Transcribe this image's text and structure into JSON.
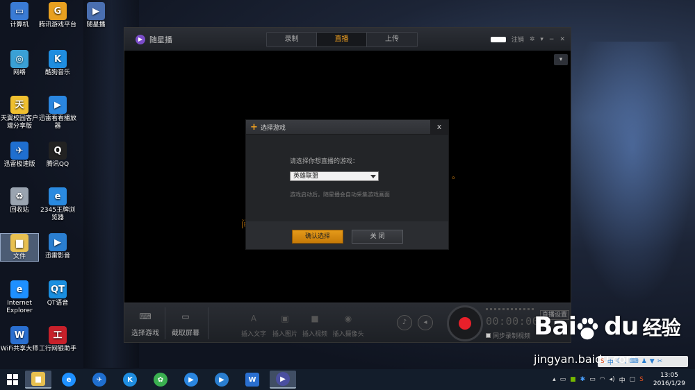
{
  "desktop": {
    "icons": [
      {
        "label": "计算机",
        "color": "#3a7bd5",
        "glyph": "▭"
      },
      {
        "label": "腾讯游戏平台",
        "color": "#e8a020",
        "glyph": "G"
      },
      {
        "label": "随星播",
        "color": "#4a6fb0",
        "glyph": "▶"
      },
      {
        "label": "网络",
        "color": "#3aa0d5",
        "glyph": "◎"
      },
      {
        "label": "酷狗音乐",
        "color": "#1f8de0",
        "glyph": "K"
      },
      {
        "label": "天翼校园客户端分享版",
        "color": "#f0c030",
        "glyph": "天"
      },
      {
        "label": "迅雷看看播放器",
        "color": "#2a86e0",
        "glyph": "▶"
      },
      {
        "label": "迅雷极速版",
        "color": "#1f6fd0",
        "glyph": "✈"
      },
      {
        "label": "腾讯QQ",
        "color": "#222",
        "glyph": "Q"
      },
      {
        "label": "回收站",
        "color": "#9aa4b0",
        "glyph": "♻"
      },
      {
        "label": "2345王牌浏览器",
        "color": "#2a8ae0",
        "glyph": "e"
      },
      {
        "label": "文件",
        "color": "#e8c050",
        "glyph": "▆"
      },
      {
        "label": "迅雷影音",
        "color": "#2a7ed0",
        "glyph": "▶"
      },
      {
        "label": "Internet Explorer",
        "color": "#1e90ff",
        "glyph": "e"
      },
      {
        "label": "QT语音",
        "color": "#1a8fe0",
        "glyph": "QT"
      },
      {
        "label": "WiFi共享大师",
        "color": "#2a6fd0",
        "glyph": "W"
      },
      {
        "label": "工行网银助手",
        "color": "#c8202a",
        "glyph": "工"
      }
    ]
  },
  "app": {
    "title": "随星播",
    "tabs": [
      {
        "label": "录制",
        "active": false
      },
      {
        "label": "直播",
        "active": true
      },
      {
        "label": "上传",
        "active": false
      }
    ],
    "logout_label": "注销",
    "skin_icon": "shirt-icon",
    "background_hint_left": "间",
    "background_hint_right": "。",
    "toolbar": {
      "select_game": "选择游戏",
      "capture_screen": "截取屏幕",
      "insert_text": "插入文字",
      "insert_image": "插入图片",
      "insert_video": "插入视频",
      "insert_camera": "插入摄像头",
      "timer": "00:00:00",
      "sync_record": "同步录制视频",
      "live_settings": "直播设置"
    },
    "colors": {
      "accent": "#f0a020",
      "record": "#e8202a"
    }
  },
  "dialog": {
    "title": "选择游戏",
    "close_glyph": "x",
    "prompt": "请选择你想直播的游戏：",
    "selected_game": "英雄联盟",
    "hint": "游戏启动后，随星播会自动采集游戏画面",
    "confirm_label": "确认选择",
    "close_label": "关 闭"
  },
  "watermark": {
    "brand": "Bai",
    "brand2": "du",
    "brand_cn": "经验",
    "url": "jingyan.baidu.com"
  },
  "taskbar": {
    "apps": [
      {
        "name": "file-explorer-icon",
        "color": "#e8c050",
        "glyph": "▆"
      },
      {
        "name": "ie-browser-icon",
        "color": "#1e90ff",
        "glyph": "e"
      },
      {
        "name": "xunlei-icon",
        "color": "#1f6fd0",
        "glyph": "✈"
      },
      {
        "name": "kugou-icon",
        "color": "#1f8de0",
        "glyph": "K"
      },
      {
        "name": "pinwheel-icon",
        "color": "#3ab050",
        "glyph": "✿"
      },
      {
        "name": "thunder-player-icon",
        "color": "#2a86e0",
        "glyph": "▶"
      },
      {
        "name": "video-player-icon",
        "color": "#2a7ed0",
        "glyph": "▶"
      },
      {
        "name": "wps-icon",
        "color": "#2a6fd0",
        "glyph": "W"
      },
      {
        "name": "suixingbo-icon",
        "color": "#4a4fa0",
        "glyph": "▶"
      }
    ],
    "ime": "中",
    "time": "13:05",
    "date": "2016/1/29"
  }
}
